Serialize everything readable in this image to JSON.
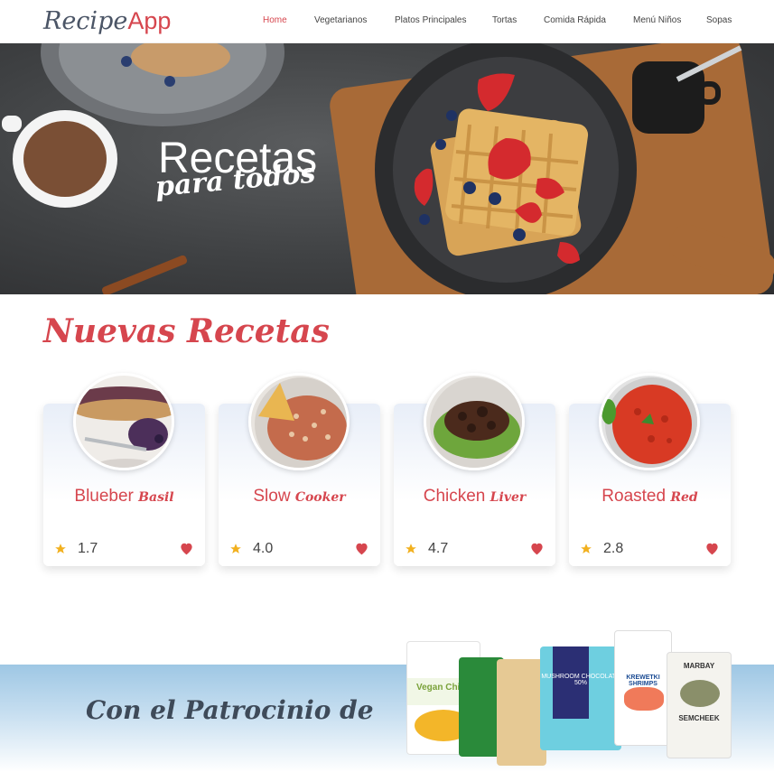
{
  "header": {
    "logo_part1": "Recipe",
    "logo_part2": "App",
    "menu": [
      {
        "label": "Home",
        "active": true
      },
      {
        "label": "Vegetarianos",
        "active": false
      },
      {
        "label": "Platos Principales",
        "active": false
      },
      {
        "label": "Tortas",
        "active": false
      },
      {
        "label": "Comida Rápida",
        "active": false
      },
      {
        "label": "Menú Niños",
        "active": false
      },
      {
        "label": "Sopas",
        "active": false
      }
    ]
  },
  "hero": {
    "title": "Recetas",
    "subtitle": "para todos"
  },
  "recipes": {
    "section_title": "Nuevas Recetas",
    "cards": [
      {
        "title_main": "Blueber",
        "title_script": "Basil",
        "rating": "1.7",
        "icon": "heart-icon"
      },
      {
        "title_main": "Slow",
        "title_script": "Cooker",
        "rating": "4.0",
        "icon": "heart-icon"
      },
      {
        "title_main": "Chicken",
        "title_script": "Liver",
        "rating": "4.7",
        "icon": "heart-icon"
      },
      {
        "title_main": "Roasted",
        "title_script": "Red",
        "rating": "2.8",
        "icon": "heart-icon"
      }
    ]
  },
  "sponsor": {
    "text": "Con el Patrocinio de",
    "packages": [
      {
        "label": "Vegan Chips"
      },
      {
        "label": "MUSHROOM CHOCOLATE 50%"
      },
      {
        "label": "KREWETKI SHRIMPS"
      },
      {
        "label": "MARBAY"
      },
      {
        "label": "SEMCHEEK"
      }
    ]
  },
  "colors": {
    "accent": "#d6464e",
    "star": "#f2b01e",
    "heart": "#d6464e"
  }
}
